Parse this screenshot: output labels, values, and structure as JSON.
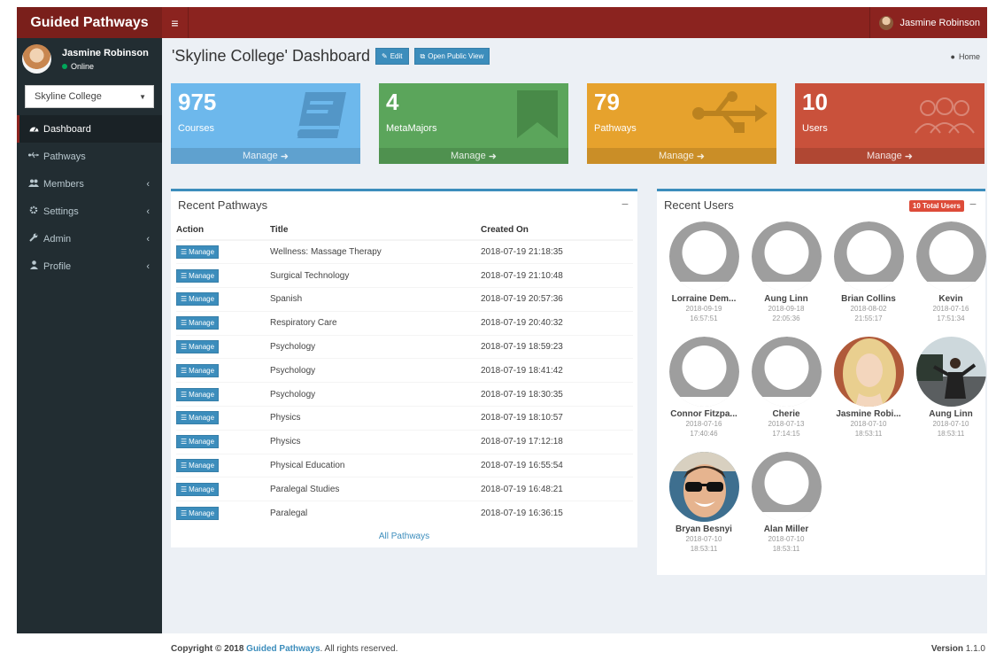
{
  "header": {
    "logo": "Guided Pathways",
    "menu_icon": "≡",
    "user_name": "Jasmine Robinson"
  },
  "sidebar": {
    "user_name": "Jasmine Robinson",
    "status": "Online",
    "college_select": "Skyline College",
    "items": [
      {
        "label": "Dashboard",
        "icon": "dashboard-icon"
      },
      {
        "label": "Pathways",
        "icon": "usb-icon"
      },
      {
        "label": "Members",
        "icon": "users-icon"
      },
      {
        "label": "Settings",
        "icon": "gear-icon"
      },
      {
        "label": "Admin",
        "icon": "wrench-icon"
      },
      {
        "label": "Profile",
        "icon": "user-icon"
      }
    ],
    "caret": "‹"
  },
  "page": {
    "title": "'Skyline College' Dashboard",
    "edit_label": "Edit",
    "public_view_label": "Open Public View",
    "breadcrumb": "Home"
  },
  "stats": [
    {
      "value": "975",
      "label": "Courses",
      "footer": "Manage",
      "color": "#6db8ec"
    },
    {
      "value": "4",
      "label": "MetaMajors",
      "footer": "Manage",
      "color": "#5ba55b"
    },
    {
      "value": "79",
      "label": "Pathways",
      "footer": "Manage",
      "color": "#e6a22d"
    },
    {
      "value": "10",
      "label": "Users",
      "footer": "Manage",
      "color": "#c9513b"
    }
  ],
  "recent_pathways": {
    "title": "Recent Pathways",
    "minus": "−",
    "columns": [
      "Action",
      "Title",
      "Created On"
    ],
    "manage_label": "Manage",
    "rows": [
      {
        "title": "Wellness: Massage Therapy",
        "created": "2018-07-19 21:18:35"
      },
      {
        "title": "Surgical Technology",
        "created": "2018-07-19 21:10:48"
      },
      {
        "title": "Spanish",
        "created": "2018-07-19 20:57:36"
      },
      {
        "title": "Respiratory Care",
        "created": "2018-07-19 20:40:32"
      },
      {
        "title": "Psychology",
        "created": "2018-07-19 18:59:23"
      },
      {
        "title": "Psychology",
        "created": "2018-07-19 18:41:42"
      },
      {
        "title": "Psychology",
        "created": "2018-07-19 18:30:35"
      },
      {
        "title": "Physics",
        "created": "2018-07-19 18:10:57"
      },
      {
        "title": "Physics",
        "created": "2018-07-19 17:12:18"
      },
      {
        "title": "Physical Education",
        "created": "2018-07-19 16:55:54"
      },
      {
        "title": "Paralegal Studies",
        "created": "2018-07-19 16:48:21"
      },
      {
        "title": "Paralegal",
        "created": "2018-07-19 16:36:15"
      }
    ],
    "all_link": "All Pathways"
  },
  "recent_users": {
    "title": "Recent Users",
    "badge": "10 Total Users",
    "minus": "−",
    "users": [
      {
        "name": "Lorraine Dem...",
        "date": "2018-09-19",
        "time": "16:57:51",
        "photo": "none"
      },
      {
        "name": "Aung Linn",
        "date": "2018-09-18",
        "time": "22:05:36",
        "photo": "none"
      },
      {
        "name": "Brian Collins",
        "date": "2018-08-02",
        "time": "21:55:17",
        "photo": "none"
      },
      {
        "name": "Kevin",
        "date": "2018-07-16",
        "time": "17:51:34",
        "photo": "none"
      },
      {
        "name": "Connor Fitzpa...",
        "date": "2018-07-16",
        "time": "17:40:46",
        "photo": "none"
      },
      {
        "name": "Cherie",
        "date": "2018-07-13",
        "time": "17:14:15",
        "photo": "none"
      },
      {
        "name": "Jasmine Robi...",
        "date": "2018-07-10",
        "time": "18:53:11",
        "photo": "blonde"
      },
      {
        "name": "Aung Linn",
        "date": "2018-07-10",
        "time": "18:53:11",
        "photo": "outdoor"
      },
      {
        "name": "Bryan Besnyi",
        "date": "2018-07-10",
        "time": "18:53:11",
        "photo": "sunglasses"
      },
      {
        "name": "Alan Miller",
        "date": "2018-07-10",
        "time": "18:53:11",
        "photo": "none"
      }
    ]
  },
  "footer": {
    "copyright_prefix": "Copyright © 2018",
    "brand": "Guided Pathways",
    "copyright_suffix": ". All rights reserved.",
    "version_label": "Version",
    "version": "1.1.0"
  }
}
